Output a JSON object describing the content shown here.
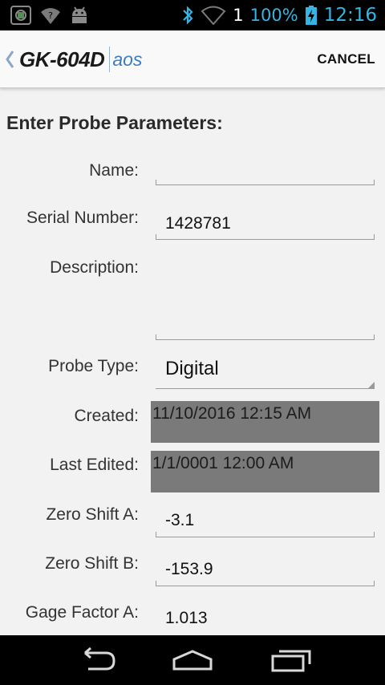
{
  "status_bar": {
    "battery_percent": "100%",
    "time": "12:16",
    "signal_text": "1"
  },
  "action_bar": {
    "logo_main": "GK-604D",
    "logo_sub": "aos",
    "cancel_label": "CANCEL"
  },
  "form": {
    "title": "Enter Probe Parameters:",
    "fields": {
      "name": {
        "label": "Name:",
        "value": ""
      },
      "serial_number": {
        "label": "Serial Number:",
        "value": "1428781"
      },
      "description": {
        "label": "Description:",
        "value": ""
      },
      "probe_type": {
        "label": "Probe Type:",
        "value": "Digital"
      },
      "created": {
        "label": "Created:",
        "value": "11/10/2016 12:15 AM"
      },
      "last_edited": {
        "label": "Last Edited:",
        "value": "1/1/0001 12:00 AM"
      },
      "zero_shift_a": {
        "label": "Zero Shift A:",
        "value": "-3.1"
      },
      "zero_shift_b": {
        "label": "Zero Shift B:",
        "value": "-153.9"
      },
      "gage_factor_a": {
        "label": "Gage Factor A:",
        "value": "1.013"
      }
    }
  },
  "colors": {
    "accent": "#33b5e5",
    "readonly_bg": "#7a7a7a",
    "logo_sub": "#3b7bbf"
  }
}
